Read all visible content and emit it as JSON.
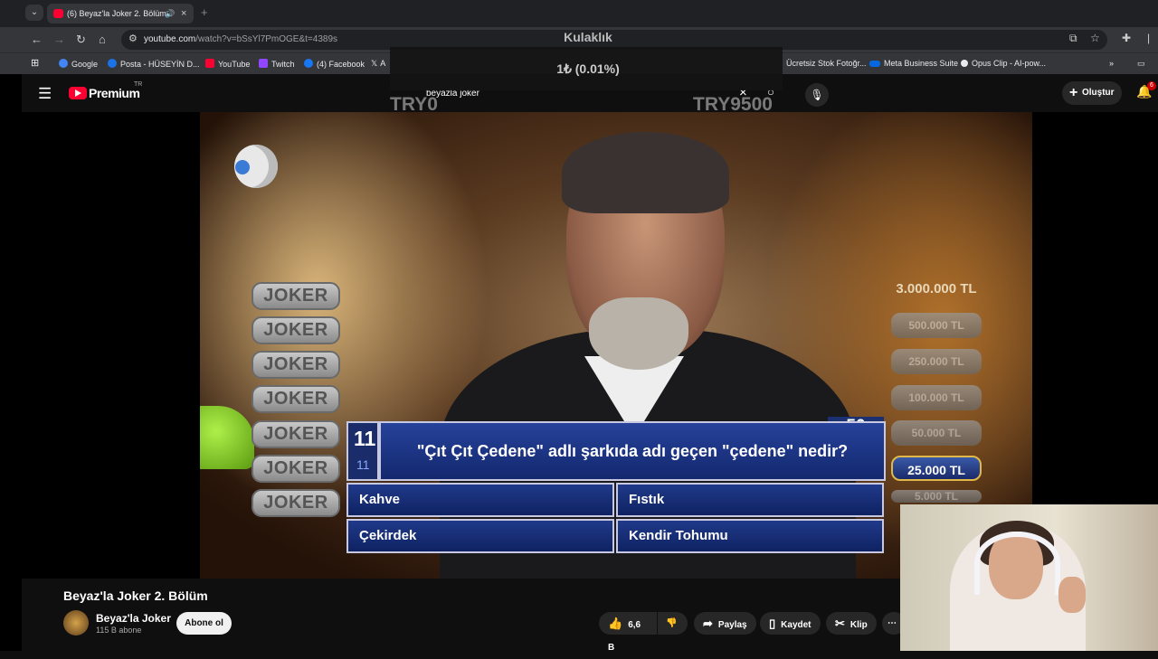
{
  "browser": {
    "tab_title": "(6) Beyaz'la Joker 2. Bölüm",
    "url_main": "youtube.com",
    "url_rest": "/watch?v=bSsYl7PmOGE&t=4389s"
  },
  "bookmarks": [
    {
      "label": "Google",
      "icon": "google-icon",
      "color": "#4285f4"
    },
    {
      "label": "Posta - HÜSEYİN D...",
      "icon": "mail-icon",
      "color": "#1a73e8"
    },
    {
      "label": "YouTube",
      "icon": "youtube-icon",
      "color": "#ff0033"
    },
    {
      "label": "Twitch",
      "icon": "twitch-icon",
      "color": "#9146ff"
    },
    {
      "label": "(4) Facebook",
      "icon": "facebook-icon",
      "color": "#1877f2"
    },
    {
      "label": "A",
      "icon": "x-icon",
      "color": "#ffffff"
    },
    {
      "label": "Ücretsiz Stok Fotoğr...",
      "icon": "photo-icon",
      "color": "#999999"
    },
    {
      "label": "Meta Business Suite",
      "icon": "meta-icon",
      "color": "#0668e1"
    },
    {
      "label": "Opus Clip - AI-pow...",
      "icon": "opus-icon",
      "color": "#e8eaed"
    }
  ],
  "stream_overlay": {
    "device": "Kulaklık",
    "donation": "1₺ (0.01%)",
    "goal_start": "TRY0",
    "goal_end": "TRY9500"
  },
  "youtube": {
    "logo_text": "Premium",
    "region": "TR",
    "search_query": "beyazla joker",
    "create_label": "Oluştur",
    "notification_count": "6"
  },
  "quiz": {
    "jokers": [
      "JOKER",
      "JOKER",
      "JOKER",
      "JOKER",
      "JOKER",
      "JOKER",
      "JOKER"
    ],
    "prize_top": "3.000.000 TL",
    "prizes_faded": [
      "500.000 TL",
      "250.000 TL",
      "100.000 TL",
      "50.000 TL",
      "5.000 TL"
    ],
    "prize_current": "25.000 TL",
    "timer": "50",
    "question_number": "11",
    "question_number_small": "11",
    "question": "\"Çıt Çıt Çedene\" adlı şarkıda adı geçen \"çedene\" nedir?",
    "answers": [
      "Kahve",
      "Fıstık",
      "Çekirdek",
      "Kendir Tohumu"
    ]
  },
  "video_info": {
    "title": "Beyaz'la Joker 2. Bölüm",
    "channel": "Beyaz'la Joker",
    "subscribers": "115 B abone",
    "subscribe_label": "Abone ol",
    "likes": "6,6 B",
    "share_label": "Paylaş",
    "save_label": "Kaydet",
    "clip_label": "Klip"
  }
}
